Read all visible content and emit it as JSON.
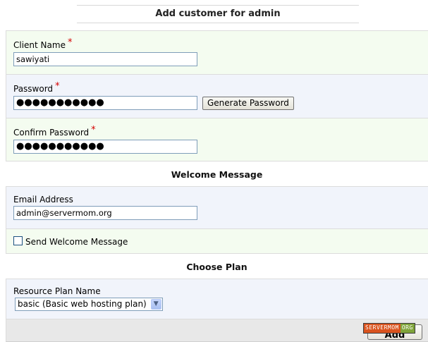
{
  "header": {
    "title": "Add customer for admin"
  },
  "form": {
    "client_name": {
      "label": "Client Name",
      "required_mark": "*",
      "value": "sawiyati"
    },
    "password": {
      "label": "Password",
      "required_mark": "*",
      "value": "●●●●●●●●●●●",
      "generate_button": "Generate Password"
    },
    "confirm_password": {
      "label": "Confirm Password",
      "required_mark": "*",
      "value": "●●●●●●●●●●●"
    }
  },
  "welcome_section": {
    "heading": "Welcome Message",
    "email_label": "Email Address",
    "email_value": "admin@servermom.org",
    "send_label": "Send Welcome Message",
    "send_checked": false
  },
  "plan_section": {
    "heading": "Choose Plan",
    "resource_label": "Resource Plan Name",
    "selected_plan": "basic (Basic web hosting plan)"
  },
  "footer": {
    "add_button": "Add",
    "watermark_a": "SERVERMOM",
    "watermark_b": "ORG"
  },
  "colors": {
    "required": "#d40000",
    "row_green": "#f4fcf0",
    "row_blue": "#f1f4fb",
    "input_border": "#7f9db9"
  }
}
